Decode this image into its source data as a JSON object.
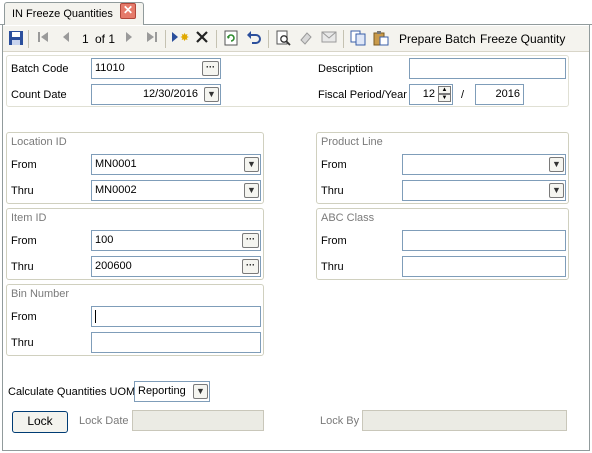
{
  "tab": {
    "title": "IN Freeze Quantities",
    "close": "✕"
  },
  "toolbar": {
    "record_position": "1",
    "record_of": "of 1",
    "prepare_batch": "Prepare Batch",
    "freeze_quantity": "Freeze Quantity"
  },
  "header": {
    "batch_code_label": "Batch Code",
    "batch_code_value": "11010",
    "count_date_label": "Count Date",
    "count_date_value": "12/30/2016",
    "description_label": "Description",
    "description_value": "",
    "fiscal_label": "Fiscal Period/Year",
    "fiscal_period": "12",
    "fiscal_sep": "/",
    "fiscal_year": "2016"
  },
  "location": {
    "title": "Location ID",
    "from_label": "From",
    "from_value": "MN0001",
    "thru_label": "Thru",
    "thru_value": "MN0002"
  },
  "product_line": {
    "title": "Product Line",
    "from_label": "From",
    "from_value": "",
    "thru_label": "Thru",
    "thru_value": ""
  },
  "item": {
    "title": "Item ID",
    "from_label": "From",
    "from_value": "100",
    "thru_label": "Thru",
    "thru_value": "200600"
  },
  "abc_class": {
    "title": "ABC Class",
    "from_label": "From",
    "from_value": "",
    "thru_label": "Thru",
    "thru_value": ""
  },
  "bin": {
    "title": "Bin Number",
    "from_label": "From",
    "from_value": "",
    "thru_label": "Thru",
    "thru_value": ""
  },
  "uom": {
    "label": "Calculate Quantities UOM",
    "value": "Reporting"
  },
  "lock": {
    "button": "Lock",
    "date_label": "Lock Date",
    "date_value": "",
    "by_label": "Lock By",
    "by_value": ""
  },
  "icons": {
    "ellipsis": "···",
    "dropdown": "▼",
    "spin_up": "▲",
    "spin_down": "▼"
  }
}
